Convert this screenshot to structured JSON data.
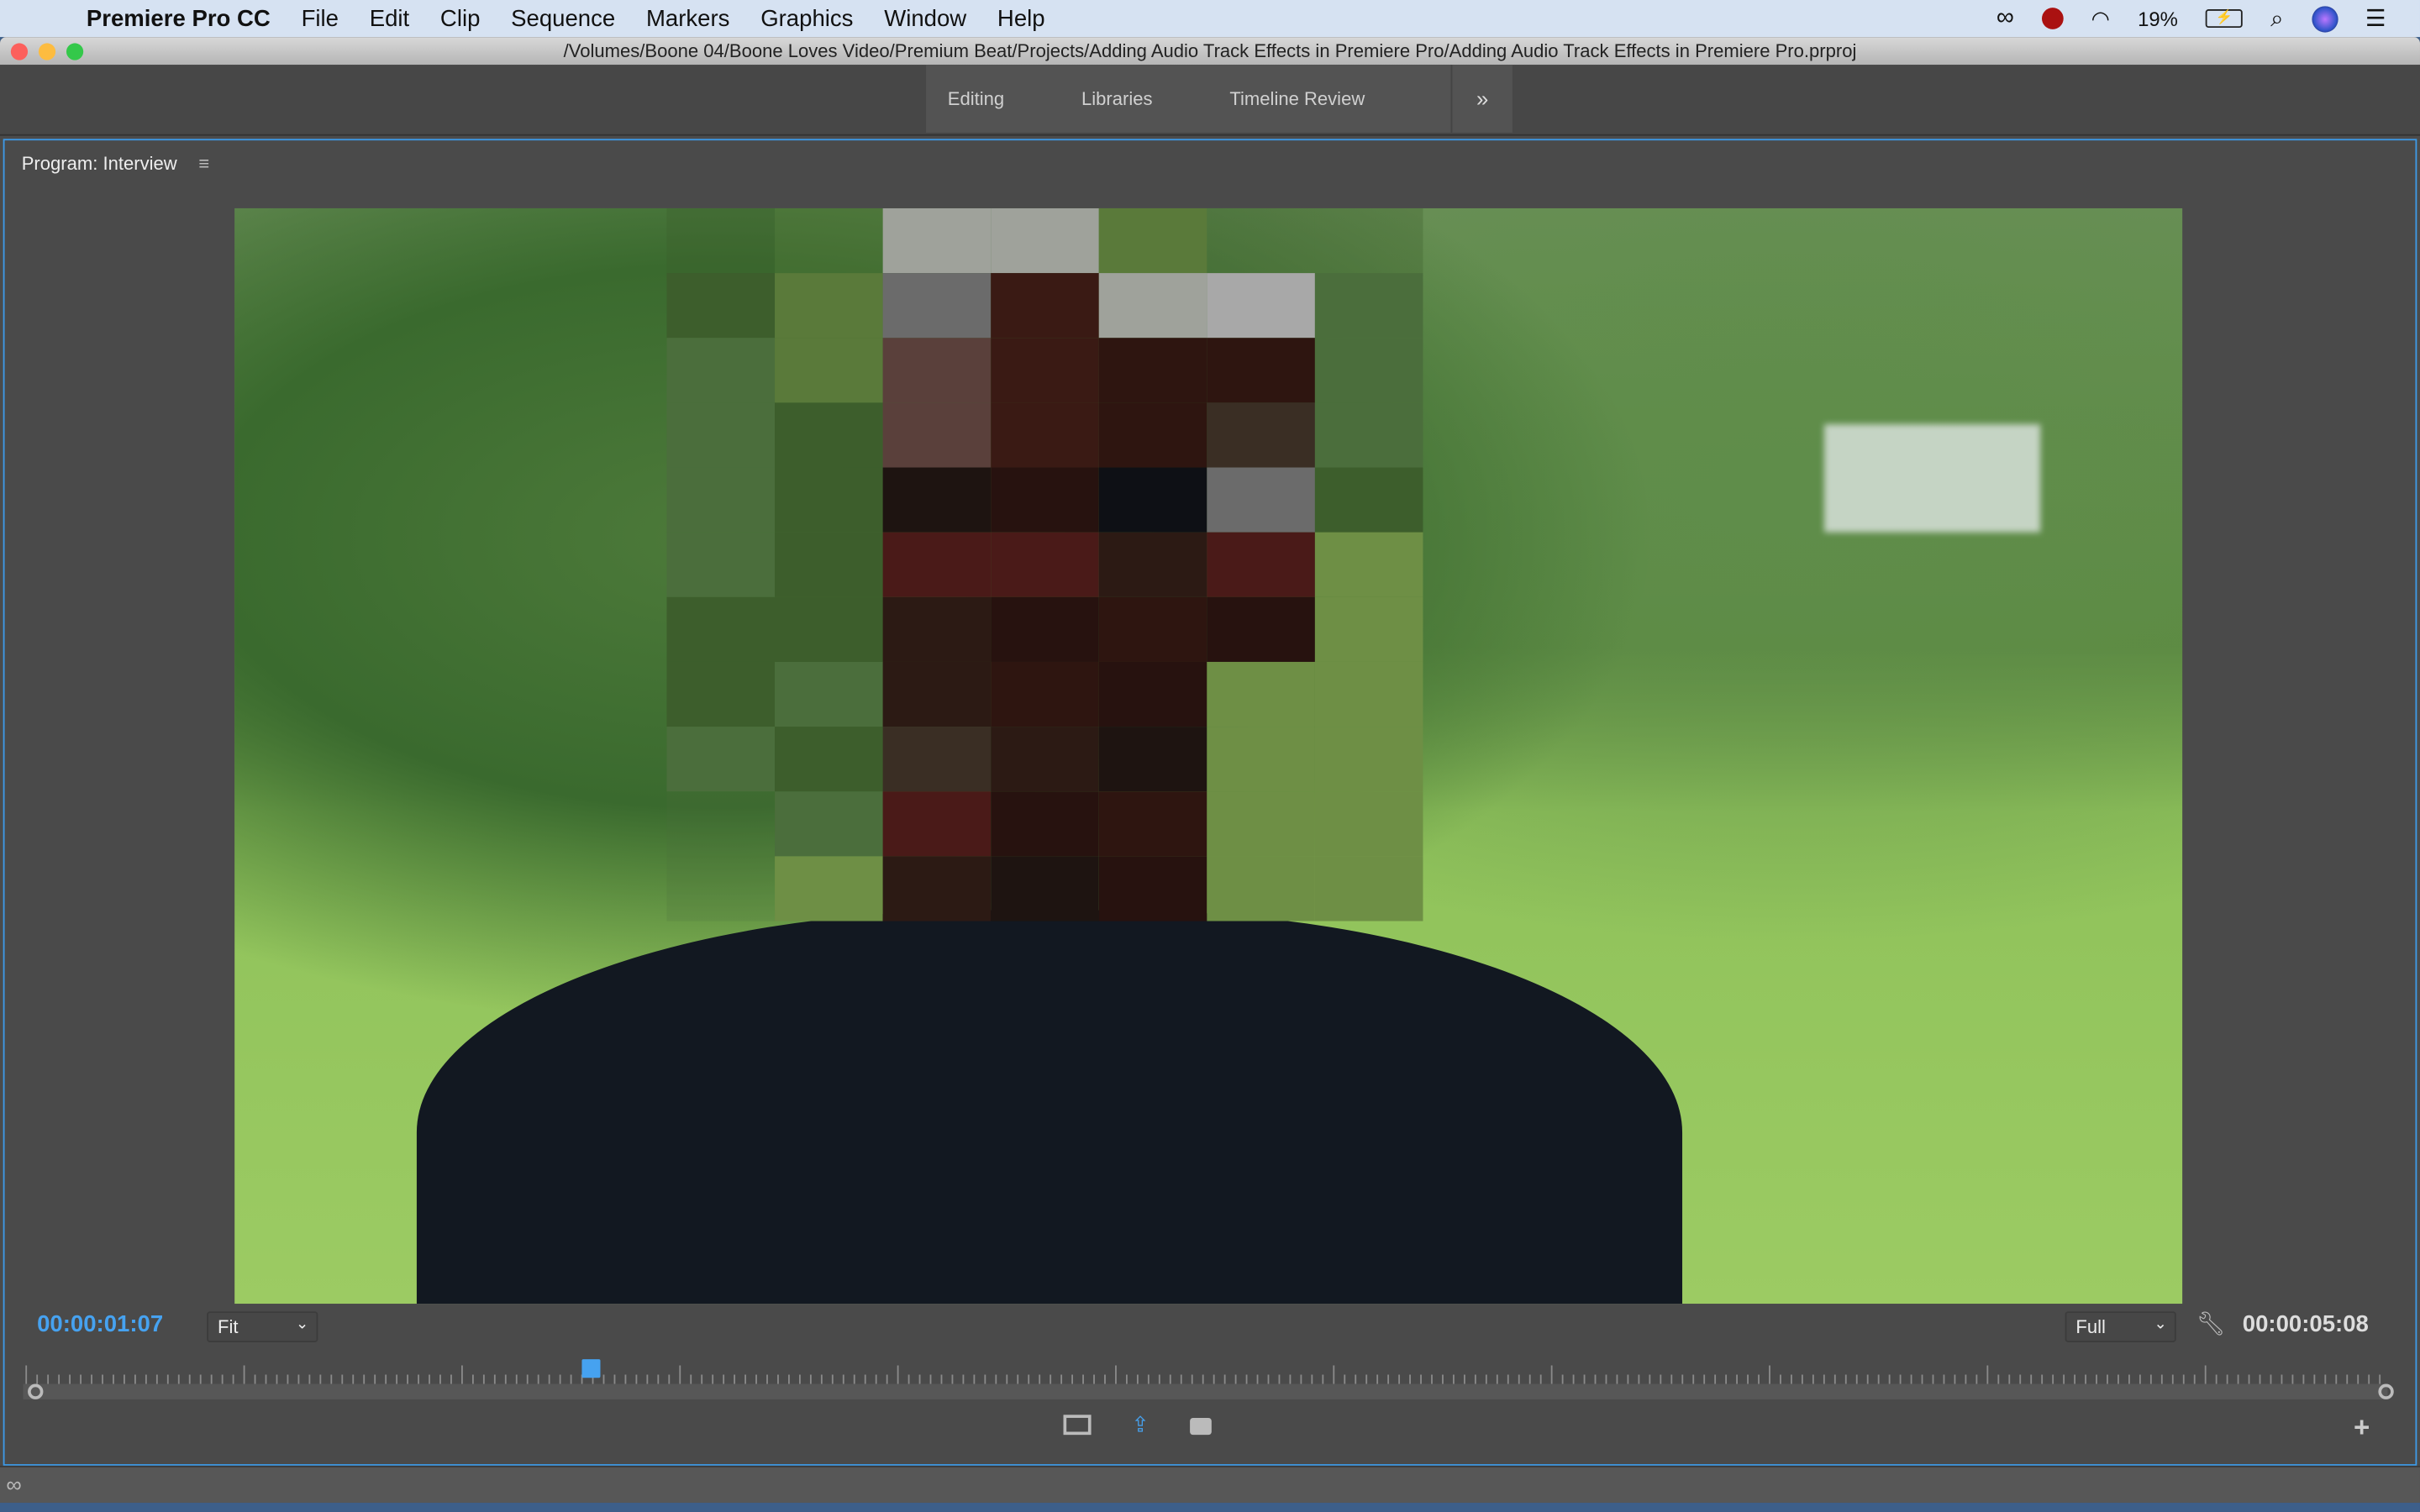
{
  "menubar": {
    "app": "Premiere Pro CC",
    "items": [
      "File",
      "Edit",
      "Clip",
      "Sequence",
      "Markers",
      "Graphics",
      "Window",
      "Help"
    ],
    "battery": "19%"
  },
  "window": {
    "title": "/Volumes/Boone 04/Boone Loves Video/Premium Beat/Projects/Adding Audio Track Effects in Premiere Pro/Adding Audio Track Effects in Premiere Pro.prproj"
  },
  "workspaces": {
    "tabs": [
      "Editing",
      "Libraries",
      "Timeline Review"
    ],
    "more": "»"
  },
  "program": {
    "title": "Program: Interview",
    "menu": "≡",
    "current_time": "00:00:01:07",
    "zoom": "Fit",
    "resolution": "Full",
    "duration": "00:00:05:08",
    "playhead_fraction": 0.24,
    "accent": "#46a2f0"
  }
}
